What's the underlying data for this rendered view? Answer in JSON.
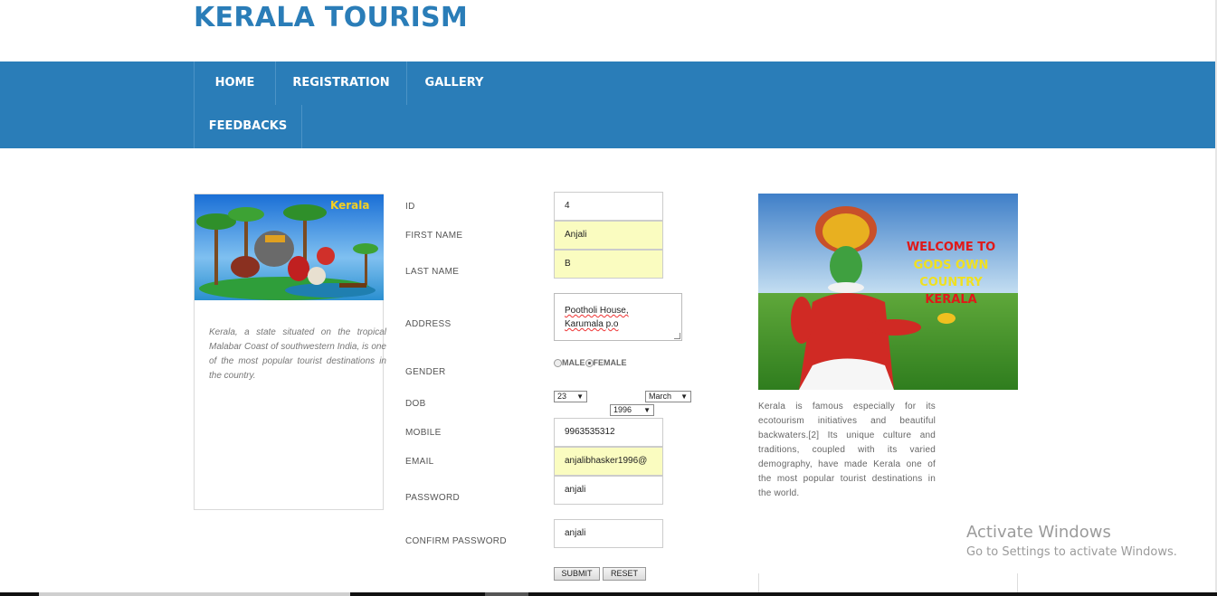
{
  "site": {
    "title": "KERALA TOURISM"
  },
  "nav": [
    {
      "label": "HOME"
    },
    {
      "label": "REGISTRATION"
    },
    {
      "label": "GALLERY"
    },
    {
      "label": "FEEDBACKS"
    }
  ],
  "left": {
    "image_caption": "Kerala",
    "text": "Kerala, a state situated on the tropical Malabar Coast of southwestern India, is one of the most popular tourist destinations in the country."
  },
  "form": {
    "id": {
      "label": "ID",
      "value": "4"
    },
    "first_name": {
      "label": "FIRST NAME",
      "value": "Anjali"
    },
    "last_name": {
      "label": "LAST NAME",
      "value": "B"
    },
    "address": {
      "label": "ADDRESS",
      "line1": "Pootholi House,",
      "line2": "Karumala p.o"
    },
    "gender": {
      "label": "GENDER",
      "options": [
        "MALE",
        "FEMALE"
      ],
      "selected": "FEMALE"
    },
    "dob": {
      "label": "DOB",
      "day": "23",
      "month": "March",
      "year": "1996"
    },
    "mobile": {
      "label": "MOBILE",
      "value": "9963535312"
    },
    "email": {
      "label": "EMAIL",
      "value": "anjalibhasker1996@"
    },
    "password": {
      "label": "PASSWORD",
      "value": "anjali"
    },
    "confirm_password": {
      "label": "CONFIRM PASSWORD",
      "value": "anjali"
    },
    "submit_label": "SUBMIT",
    "reset_label": "RESET"
  },
  "right": {
    "banner_line1": "WELCOME TO",
    "banner_line2": "GODS OWN",
    "banner_line3": "COUNTRY",
    "banner_line4": "KERALA",
    "text": "Kerala is famous especially for its ecotourism initiatives and beautiful backwaters.[2] Its unique culture and traditions, coupled with its varied demography, have made Kerala one of the most popular tourist destinations in the world."
  },
  "watermark": {
    "title": "Activate Windows",
    "subtitle": "Go to Settings to activate Windows."
  },
  "colors": {
    "brand_blue": "#2a7db8",
    "highlight_yellow": "#fafcc0"
  }
}
